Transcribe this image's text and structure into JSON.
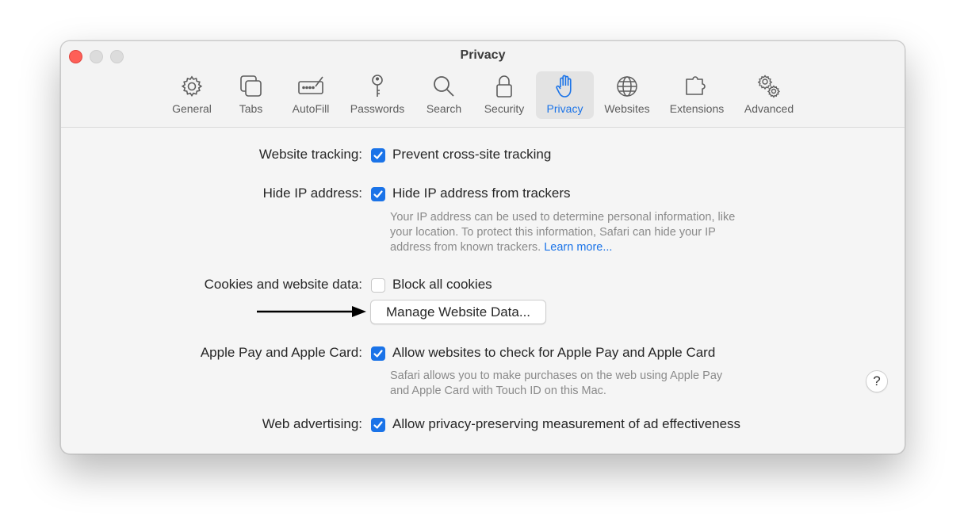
{
  "window": {
    "title": "Privacy"
  },
  "tabs": [
    {
      "label": "General",
      "icon": "gear-icon"
    },
    {
      "label": "Tabs",
      "icon": "tabs-icon"
    },
    {
      "label": "AutoFill",
      "icon": "autofill-icon"
    },
    {
      "label": "Passwords",
      "icon": "key-icon"
    },
    {
      "label": "Search",
      "icon": "magnifier-icon"
    },
    {
      "label": "Security",
      "icon": "lock-icon"
    },
    {
      "label": "Privacy",
      "icon": "hand-icon",
      "selected": true
    },
    {
      "label": "Websites",
      "icon": "globe-icon"
    },
    {
      "label": "Extensions",
      "icon": "puzzle-icon"
    },
    {
      "label": "Advanced",
      "icon": "gears-icon"
    }
  ],
  "settings": {
    "website_tracking": {
      "label": "Website tracking:",
      "option": "Prevent cross-site tracking",
      "checked": true
    },
    "hide_ip": {
      "label": "Hide IP address:",
      "option": "Hide IP address from trackers",
      "checked": true,
      "description_lines": [
        "Your IP address can be used to determine personal information, like",
        "your location. To protect this information, Safari can hide your IP",
        "address from known trackers."
      ],
      "learn_more": "Learn more..."
    },
    "cookies": {
      "label": "Cookies and website data:",
      "option": "Block all cookies",
      "checked": false,
      "button": "Manage Website Data..."
    },
    "apple_pay": {
      "label": "Apple Pay and Apple Card:",
      "option": "Allow websites to check for Apple Pay and Apple Card",
      "checked": true,
      "description_lines": [
        "Safari allows you to make purchases on the web using Apple Pay",
        "and Apple Card with Touch ID on this Mac."
      ]
    },
    "web_advertising": {
      "label": "Web advertising:",
      "option": "Allow privacy-preserving measurement of ad effectiveness",
      "checked": true
    }
  },
  "help_button": "?",
  "colors": {
    "accent": "#1a73e8",
    "close": "#fe5f57"
  }
}
